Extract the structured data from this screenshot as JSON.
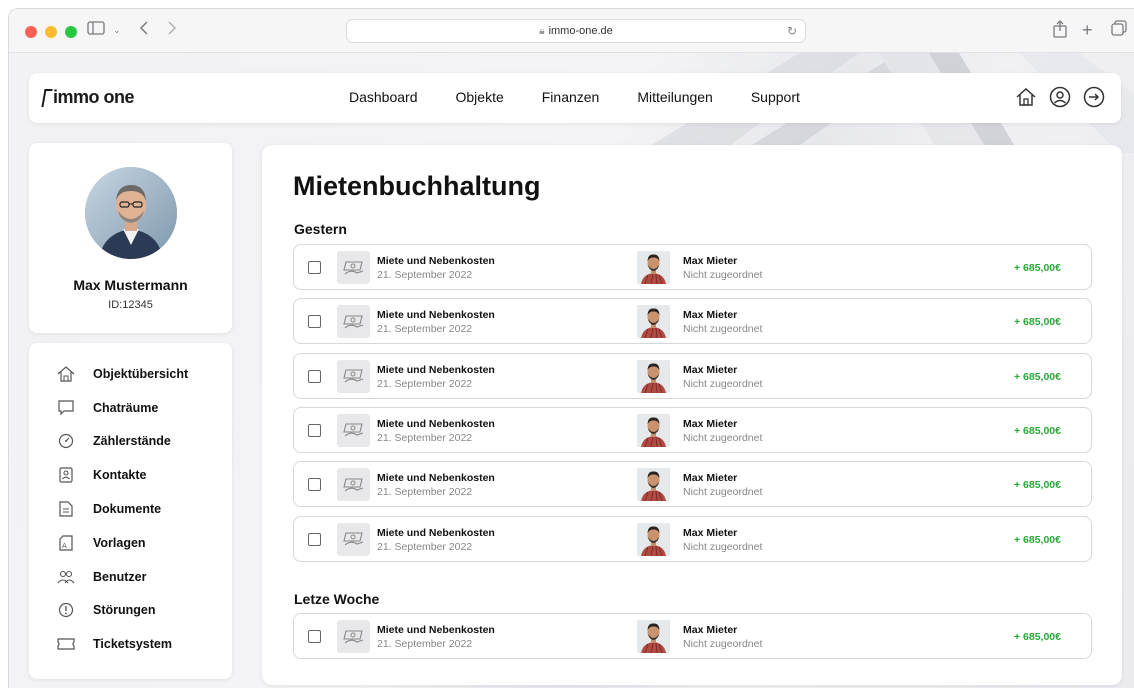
{
  "browser": {
    "url": "immo-one.de"
  },
  "header": {
    "logo": "immo one",
    "nav": [
      "Dashboard",
      "Objekte",
      "Finanzen",
      "Mitteilungen",
      "Support"
    ]
  },
  "profile": {
    "name": "Max Mustermann",
    "id": "ID:12345"
  },
  "sidebar": {
    "items": [
      {
        "label": "Objektübersicht",
        "icon": "home-icon"
      },
      {
        "label": "Chaträume",
        "icon": "chat-icon"
      },
      {
        "label": "Zählerstände",
        "icon": "meter-icon"
      },
      {
        "label": "Kontakte",
        "icon": "contact-icon"
      },
      {
        "label": "Dokumente",
        "icon": "document-icon"
      },
      {
        "label": "Vorlagen",
        "icon": "template-icon"
      },
      {
        "label": "Benutzer",
        "icon": "users-icon"
      },
      {
        "label": "Störungen",
        "icon": "alert-icon"
      },
      {
        "label": "Ticketsystem",
        "icon": "ticket-icon"
      }
    ]
  },
  "main": {
    "title": "Mietenbuchhaltung",
    "groups": [
      {
        "label": "Gestern",
        "rows": [
          {
            "title": "Miete und Nebenkosten",
            "date": "21. September 2022",
            "person": "Max Mieter",
            "status": "Nicht zugeordnet",
            "amount": "+ 685,00€"
          },
          {
            "title": "Miete und Nebenkosten",
            "date": "21. September 2022",
            "person": "Max Mieter",
            "status": "Nicht zugeordnet",
            "amount": "+ 685,00€"
          },
          {
            "title": "Miete und Nebenkosten",
            "date": "21. September 2022",
            "person": "Max Mieter",
            "status": "Nicht zugeordnet",
            "amount": "+ 685,00€"
          },
          {
            "title": "Miete und Nebenkosten",
            "date": "21. September 2022",
            "person": "Max Mieter",
            "status": "Nicht zugeordnet",
            "amount": "+ 685,00€"
          },
          {
            "title": "Miete und Nebenkosten",
            "date": "21. September 2022",
            "person": "Max Mieter",
            "status": "Nicht zugeordnet",
            "amount": "+ 685,00€"
          },
          {
            "title": "Miete und Nebenkosten",
            "date": "21. September 2022",
            "person": "Max Mieter",
            "status": "Nicht zugeordnet",
            "amount": "+ 685,00€"
          }
        ]
      },
      {
        "label": "Letze Woche",
        "rows": [
          {
            "title": "Miete und Nebenkosten",
            "date": "21. September 2022",
            "person": "Max Mieter",
            "status": "Nicht zugeordnet",
            "amount": "+ 685,00€"
          }
        ]
      }
    ]
  },
  "colors": {
    "amount_positive": "#2aa838",
    "accent": "#111111"
  }
}
